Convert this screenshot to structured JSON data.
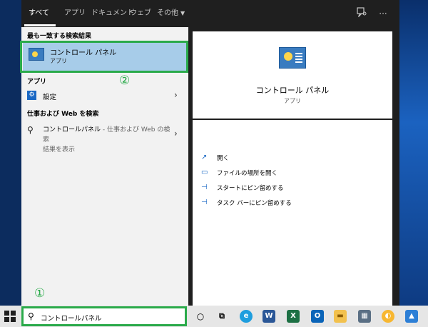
{
  "tabs": [
    {
      "label": "すべて"
    },
    {
      "label": "アプリ"
    },
    {
      "label": "ドキュメント"
    },
    {
      "label": "ウェブ"
    },
    {
      "label": "その他"
    }
  ],
  "tab_icons": {
    "feedback": "feedback-icon",
    "more": "···"
  },
  "best_match": {
    "heading": "最も一致する検索結果",
    "title": "コントロール パネル",
    "subtitle": "アプリ"
  },
  "apps": {
    "heading": "アプリ",
    "items": [
      {
        "label": "設定"
      }
    ]
  },
  "web": {
    "heading": "仕事および Web を検索",
    "query": "コントロールパネル",
    "hint": " - 仕事および Web の検索",
    "hint2": "結果を表示"
  },
  "preview": {
    "title": "コントロール パネル",
    "subtitle": "アプリ"
  },
  "actions": [
    {
      "label": "開く"
    },
    {
      "label": "ファイルの場所を開く"
    },
    {
      "label": "スタートにピン留めする"
    },
    {
      "label": "タスク バーにピン留めする"
    }
  ],
  "annotations": {
    "one": "①",
    "two": "②"
  },
  "search": {
    "value": "コントロールパネル"
  },
  "taskbar_icons": [
    "cortana-icon",
    "task-view-icon",
    "edge-icon",
    "word-icon",
    "excel-icon",
    "outlook-icon",
    "file-explorer-icon",
    "calculator-icon",
    "chrome-canary-icon",
    "photos-icon"
  ],
  "colors": {
    "highlight_green": "#2aaa4a",
    "selection_blue": "#a7cce9",
    "accent": "#1a68c4"
  }
}
